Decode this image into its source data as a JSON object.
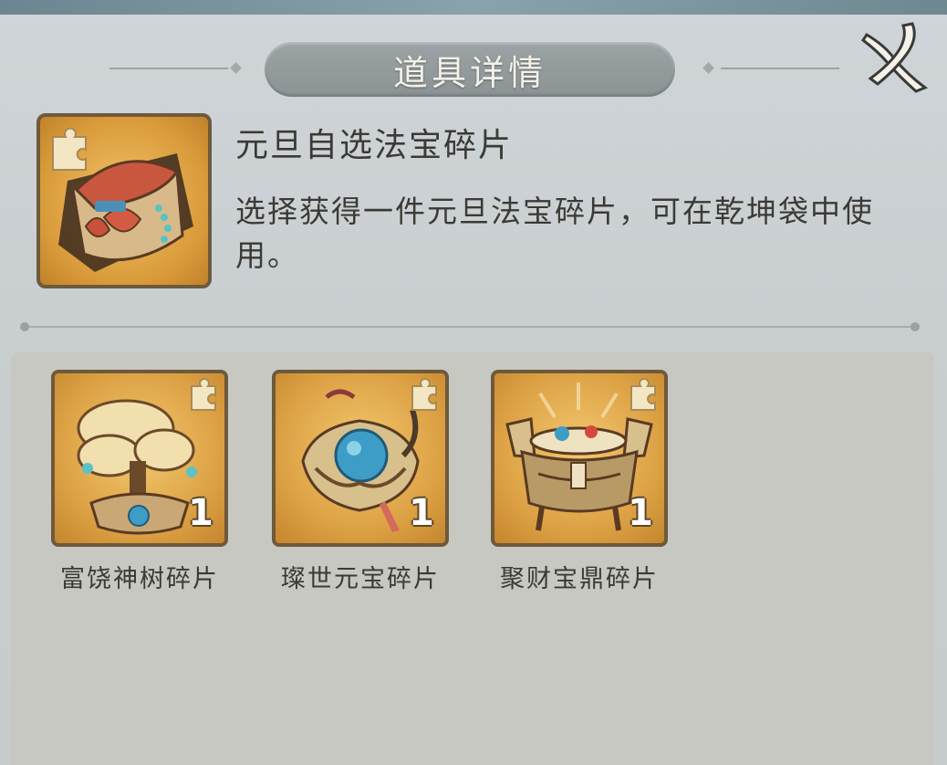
{
  "header": {
    "title": "道具详情",
    "close_icon": "close-icon"
  },
  "item": {
    "name": "元旦自选法宝碎片",
    "description": "选择获得一件元旦法宝碎片，可在乾坤袋中使用。",
    "icon": "treasure-chest-icon"
  },
  "rewards": [
    {
      "label": "富饶神树碎片",
      "count": "1",
      "icon": "money-tree-icon"
    },
    {
      "label": "璨世元宝碎片",
      "count": "1",
      "icon": "golden-ingot-icon"
    },
    {
      "label": "聚财宝鼎碎片",
      "count": "1",
      "icon": "treasure-cauldron-icon"
    }
  ],
  "colors": {
    "tile_gold": "#dca043",
    "tile_border": "#6e5a3b",
    "title_plate": "#8b9395",
    "text_dark": "#3b3a36"
  }
}
